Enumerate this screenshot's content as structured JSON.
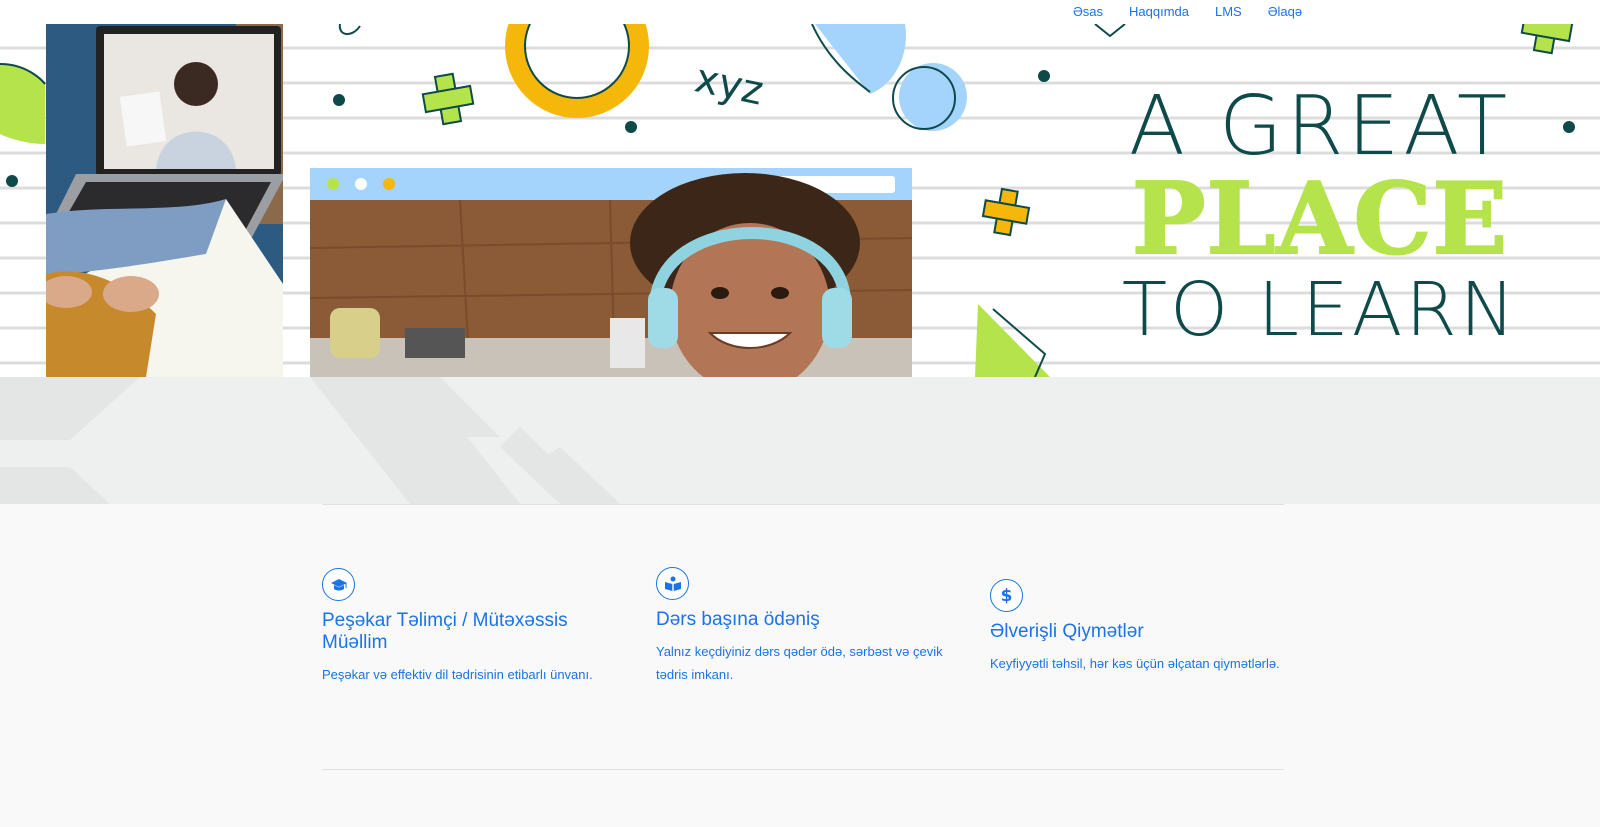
{
  "nav": {
    "items": [
      {
        "label": "Əsas"
      },
      {
        "label": "Haqqımda"
      },
      {
        "label": "LMS"
      },
      {
        "label": "Əlaqə"
      }
    ]
  },
  "hero": {
    "headline_line1": "A GREAT",
    "headline_line2": "PLACE",
    "headline_line3": "TO LEARN",
    "doodle_text": "xyz"
  },
  "features": [
    {
      "icon": "graduation-cap-icon",
      "title": "Peşəkar Təlimçi / Mütəxəssis Müəllim",
      "desc": "Peşəkar və effektiv dil tədrisinin etibarlı ünvanı."
    },
    {
      "icon": "open-book-icon",
      "title": "Dərs başına ödəniş",
      "desc": "Yalnız keçdiyiniz dərs qədər ödə, sərbəst və çevik tədris imkanı."
    },
    {
      "icon": "dollar-icon",
      "title": "Əlverişli Qiymətlər",
      "desc": "Keyfiyyətli təhsil, hər kəs üçün əlçatan qiymətlərlə."
    }
  ],
  "colors": {
    "link": "#1a73e8",
    "headline_dark": "#0f4a4a",
    "headline_accent": "#b5e34c",
    "band": "#eeefef"
  }
}
